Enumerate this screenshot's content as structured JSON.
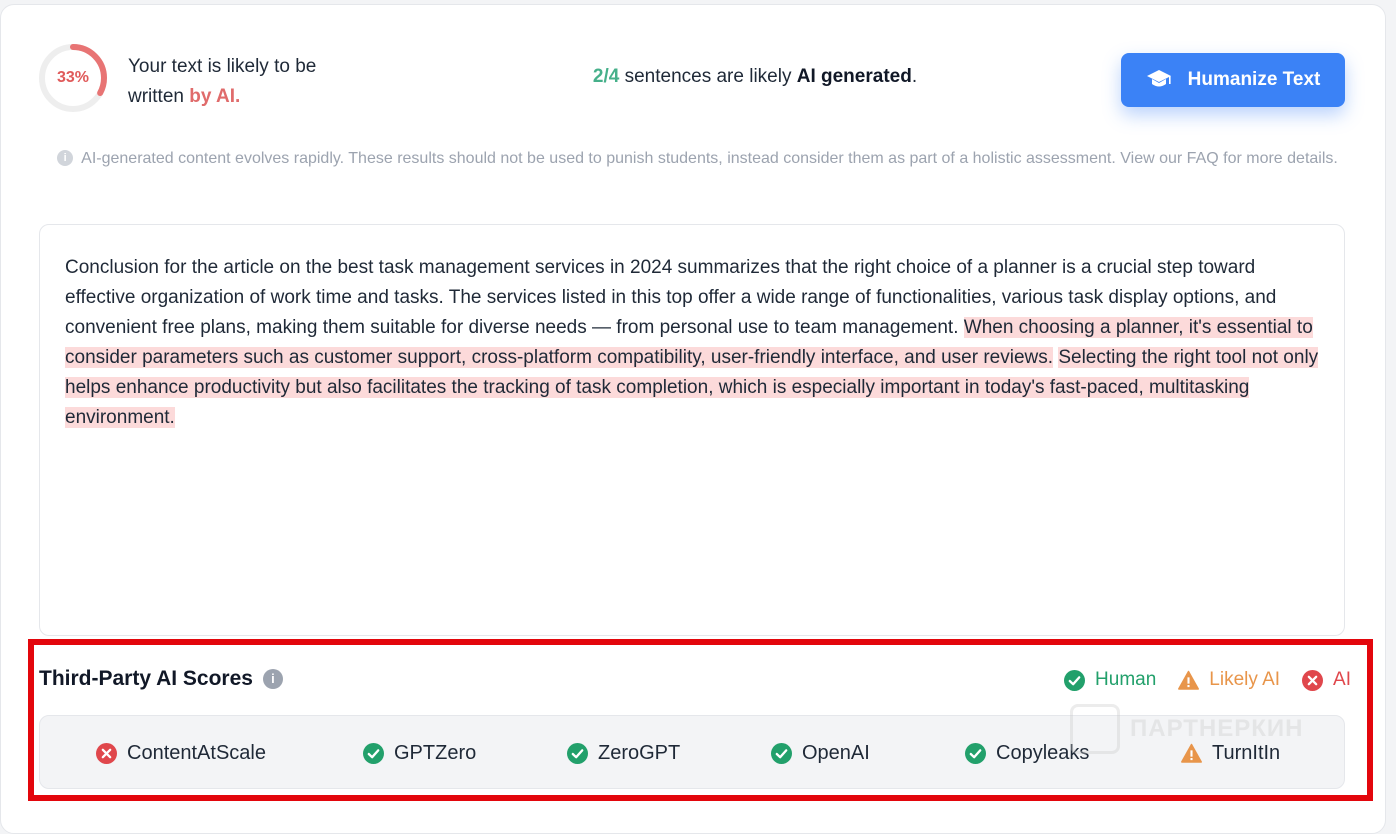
{
  "header": {
    "gauge_percent": 33,
    "gauge_label": "33%",
    "likely_prefix": "Your text is likely to be written ",
    "likely_highlight": "by AI.",
    "sentences_count": "2/4",
    "sentences_mid": " sentences are likely ",
    "sentences_bold": "AI generated",
    "sentences_end": ".",
    "humanize_label": "Humanize Text",
    "humanize_icon": "graduation-cap-icon"
  },
  "disclaimer": {
    "icon": "info-icon",
    "text": "AI-generated content evolves rapidly. These results should not be used to punish students, instead consider them as part of a holistic assessment. View our FAQ for more details."
  },
  "text": {
    "plain": "Conclusion for the article on the best task management services in 2024 summarizes that the right choice of a planner is a crucial step toward effective organization of work time and tasks. The services listed in this top offer a wide range of functionalities, various task display options, and convenient free plans, making them suitable for diverse needs — from personal use to team management. ",
    "highlighted_1": "When choosing a planner, it's essential to consider parameters such as customer support, cross-platform compatibility, user-friendly interface, and user reviews.",
    "space": " ",
    "highlighted_2": "Selecting the right tool not only helps enhance productivity but also facilitates the tracking of task completion, which is especially important in today's fast-paced, multitasking environment."
  },
  "third_party": {
    "title": "Third-Party AI Scores",
    "legend": {
      "human": "Human",
      "likely_ai": "Likely AI",
      "ai": "AI"
    },
    "scores": [
      {
        "name": "ContentAtScale",
        "status": "ai"
      },
      {
        "name": "GPTZero",
        "status": "human"
      },
      {
        "name": "ZeroGPT",
        "status": "human"
      },
      {
        "name": "OpenAI",
        "status": "human"
      },
      {
        "name": "Copyleaks",
        "status": "human"
      },
      {
        "name": "TurnItIn",
        "status": "likely_ai"
      }
    ]
  },
  "watermark": "ПАРТНЕРКИН",
  "colors": {
    "accent": "#3b82f6",
    "human": "#22a06b",
    "likely_ai": "#e8954a",
    "ai": "#e0474c",
    "highlight": "#fcdada",
    "frame": "#e3060c"
  }
}
